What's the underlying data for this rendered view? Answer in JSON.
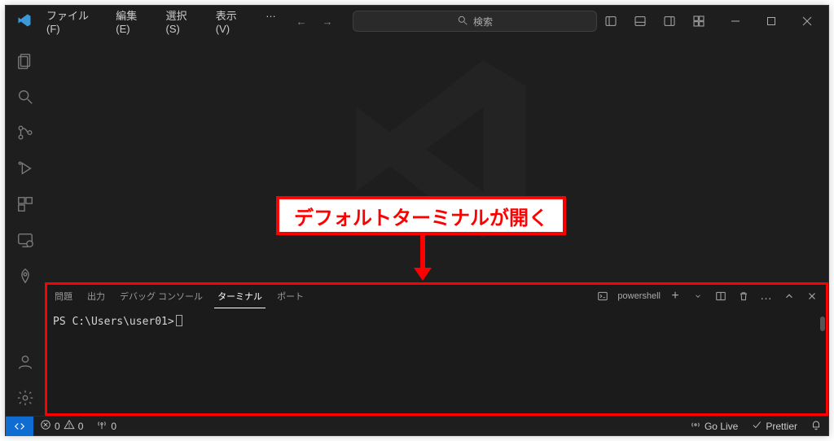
{
  "menubar": {
    "items": [
      "ファイル(F)",
      "編集(E)",
      "選択(S)",
      "表示(V)"
    ],
    "overflow": "…"
  },
  "search": {
    "placeholder": "検索",
    "icon": "search-icon"
  },
  "activitybar": {
    "items": [
      {
        "name": "explorer-icon"
      },
      {
        "name": "search-icon"
      },
      {
        "name": "source-control-icon"
      },
      {
        "name": "debug-icon"
      },
      {
        "name": "extensions-icon"
      },
      {
        "name": "remote-explorer-icon"
      },
      {
        "name": "testing-icon"
      }
    ],
    "bottom": [
      {
        "name": "account-icon"
      },
      {
        "name": "gear-icon"
      }
    ]
  },
  "panel": {
    "tabs": [
      "問題",
      "出力",
      "デバッグ コンソール",
      "ターミナル",
      "ポート"
    ],
    "active_index": 3,
    "terminal": {
      "profile_name": "powershell",
      "prompt": "PS C:\\Users\\user01>"
    },
    "actions": {
      "new": "+",
      "split": "split-icon",
      "kill": "trash-icon",
      "more": "…",
      "maximize": "chevron-up-icon",
      "close": "close-icon"
    }
  },
  "statusbar": {
    "errors": "0",
    "warnings": "0",
    "ports": "0",
    "golive": "Go Live",
    "prettier": "Prettier"
  },
  "annotation": {
    "text": "デフォルトターミナルが開く"
  }
}
